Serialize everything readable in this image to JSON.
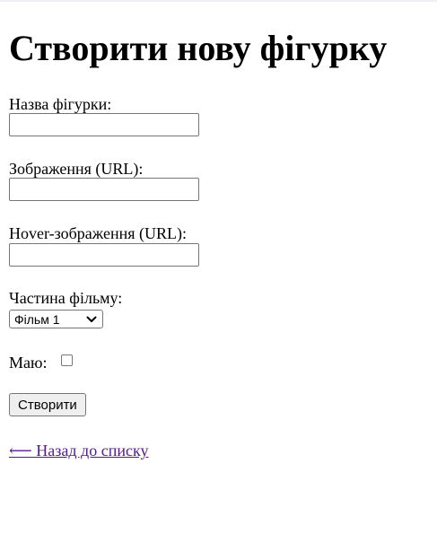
{
  "page": {
    "title": "Створити нову фігурку"
  },
  "form": {
    "name_label": "Назва фігурки:",
    "name_value": "",
    "image_label": "Зображення (URL):",
    "image_value": "",
    "hover_label": "Hover-зображення (URL):",
    "hover_value": "",
    "film_label": "Частина фільму:",
    "film_selected": "Фільм 1",
    "owned_label": "Маю:",
    "owned_checked": false,
    "submit_label": "Створити"
  },
  "nav": {
    "back_link": "⟵ Назад до списку"
  },
  "icons": {
    "select_chevron": "chevron-down-icon",
    "back_arrow": "arrow-left-icon"
  },
  "colors": {
    "link_visited": "#551a8b",
    "button_bg": "#efefef",
    "border": "#767676"
  }
}
